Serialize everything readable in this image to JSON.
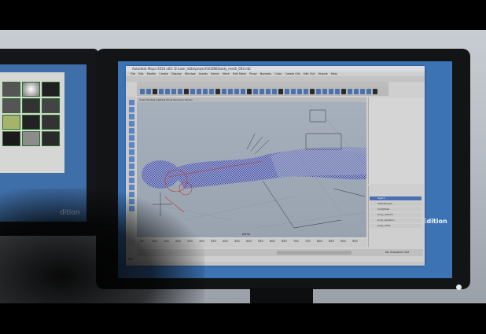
{
  "left_monitor": {
    "edition_text": "dition"
  },
  "main_monitor": {
    "edition_text": "Edition",
    "maya": {
      "window_title": "Autodesk Maya 2010 x64: D:\\user_data\\project\\SCENE\\body_mesh_003.mb",
      "menu": [
        "File",
        "Edit",
        "Modify",
        "Create",
        "Display",
        "Window",
        "Assets",
        "Select",
        "Mesh",
        "Edit Mesh",
        "Proxy",
        "Normals",
        "Color",
        "Create UVs",
        "Edit UVs",
        "Muscle",
        "Help"
      ],
      "panel_menu": "View  Shading  Lighting  Show  Renderer  Panels",
      "viewport_label": "persp",
      "layers": [
        "layer1",
        "defaultLayer",
        "bodyMesh",
        "body_refCam",
        "body_skeleton",
        "body_CTRL"
      ],
      "selected_layer": "layer1",
      "timeline_numbers": [
        "50",
        "100",
        "150",
        "200",
        "250",
        "300",
        "350",
        "400",
        "450",
        "500",
        "550",
        "600",
        "650",
        "700",
        "750",
        "800",
        "850",
        "900",
        "950"
      ],
      "range_end_label": "No Character Set",
      "command_label": "MEL"
    }
  },
  "colors": {
    "screen_bg": "#3c73b5",
    "mesh_blue": "#2a2fc9",
    "ui_gray": "#cfcfcf"
  }
}
